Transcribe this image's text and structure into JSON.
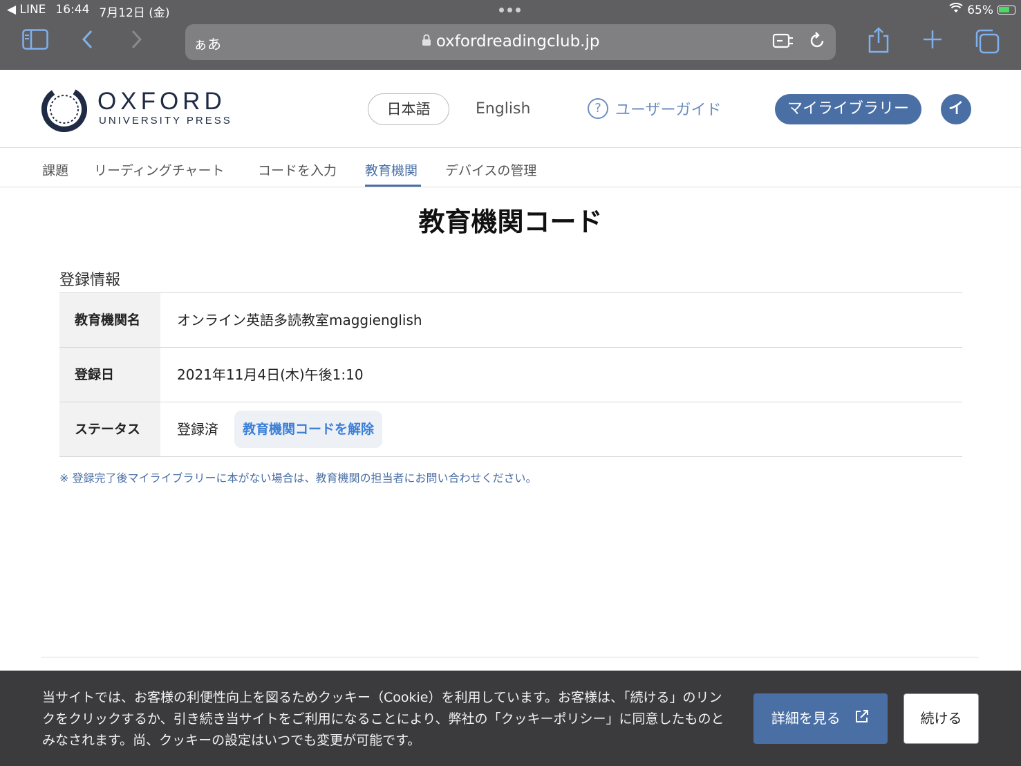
{
  "status_bar": {
    "back_app": "◀ LINE",
    "time": "16:44",
    "date": "7月12日 (金)",
    "battery": "65%"
  },
  "browser": {
    "text_size_label": "ぁあ",
    "url": "oxfordreadingclub.jp"
  },
  "header": {
    "logo_word": "OXFORD",
    "logo_sub": "UNIVERSITY PRESS",
    "lang_jp": "日本語",
    "lang_en": "English",
    "guide": "ユーザーガイド",
    "my_library": "マイライブラリー",
    "avatar_initial": "イ"
  },
  "subnav": {
    "items": [
      {
        "label": "課題"
      },
      {
        "label": "リーディングチャート"
      },
      {
        "label": "コードを入力"
      },
      {
        "label": "教育機関"
      },
      {
        "label": "デバイスの管理"
      }
    ],
    "active": "教育機関"
  },
  "main": {
    "title": "教育機関コード",
    "section_label": "登録情報",
    "rows": [
      {
        "key": "教育機関名",
        "value": "オンライン英語多読教室maggienglish"
      },
      {
        "key": "登録日",
        "value": "2021年11月4日(木)午後1:10"
      },
      {
        "key": "ステータス",
        "value": "登録済"
      }
    ],
    "unlink_button": "教育機関コードを解除",
    "note": "※ 登録完了後マイライブラリーに本がない場合は、教育機関の担当者にお問い合わせください。"
  },
  "cookie_banner": {
    "text": "当サイトでは、お客様の利便性向上を図るためクッキー（Cookie）を利用しています。お客様は、「続ける」のリンクをクリックするか、引き続き当サイトをご利用になることにより、弊社の「クッキーポリシー」に同意したものとみなされます。尚、クッキーの設定はいつでも変更が可能です。",
    "details_button": "詳細を見る",
    "continue_button": "続ける"
  },
  "colors": {
    "brand": "#4a6fa5",
    "link": "#3c7fd6",
    "chrome": "#5f5f61",
    "banner": "#3b3b3d"
  }
}
